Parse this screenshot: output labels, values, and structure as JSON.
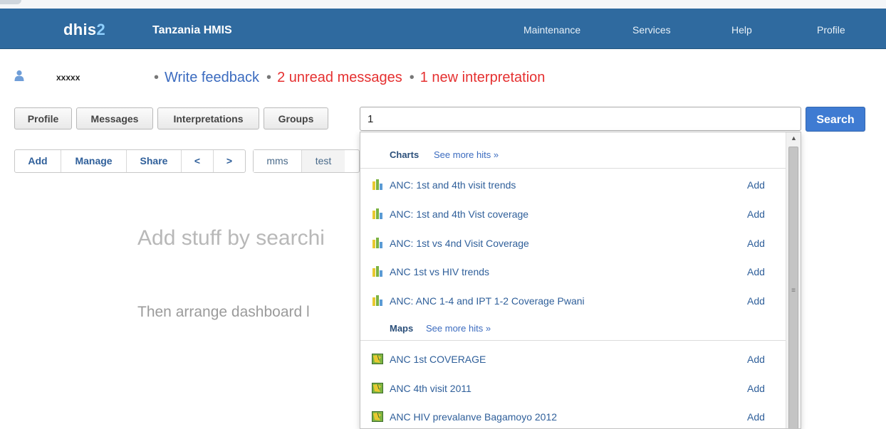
{
  "header": {
    "logo_main": "dhis",
    "logo_num": "2",
    "app_name": "Tanzania HMIS",
    "nav": [
      "Maintenance",
      "Services",
      "Help",
      "Profile"
    ]
  },
  "user": {
    "name": "xxxxx",
    "feedback": "Write feedback",
    "messages": "2 unread messages",
    "interpretations": "1 new interpretation",
    "bullet": "•"
  },
  "tabs": [
    "Profile",
    "Messages",
    "Interpretations",
    "Groups"
  ],
  "search": {
    "value": "1",
    "button": "Search"
  },
  "toolbar": {
    "actions": [
      "Add",
      "Manage",
      "Share",
      "<",
      ">"
    ],
    "dashboards": [
      "mms",
      "test"
    ]
  },
  "hints": {
    "line1": "Add stuff by searchi",
    "line2": "Then arrange dashboard l"
  },
  "dropdown": {
    "more_label": "See more hits »",
    "add_label": "Add",
    "sections": [
      {
        "title": "Charts",
        "icon": "chart-icon",
        "items": [
          "ANC: 1st and 4th visit trends",
          "ANC: 1st and 4th Vist coverage",
          "ANC: 1st vs 4nd Visit Coverage",
          "ANC 1st vs HIV trends",
          "ANC: ANC 1-4 and IPT 1-2 Coverage Pwani"
        ]
      },
      {
        "title": "Maps",
        "icon": "map-icon",
        "items": [
          "ANC 1st COVERAGE",
          "ANC 4th visit 2011",
          "ANC HIV prevalanve Bagamoyo 2012"
        ]
      }
    ]
  },
  "colors": {
    "header_bg": "#2f6a9f",
    "link_blue": "#3b6bbf",
    "alert_red": "#e53030",
    "search_btn": "#3f7bd2"
  }
}
